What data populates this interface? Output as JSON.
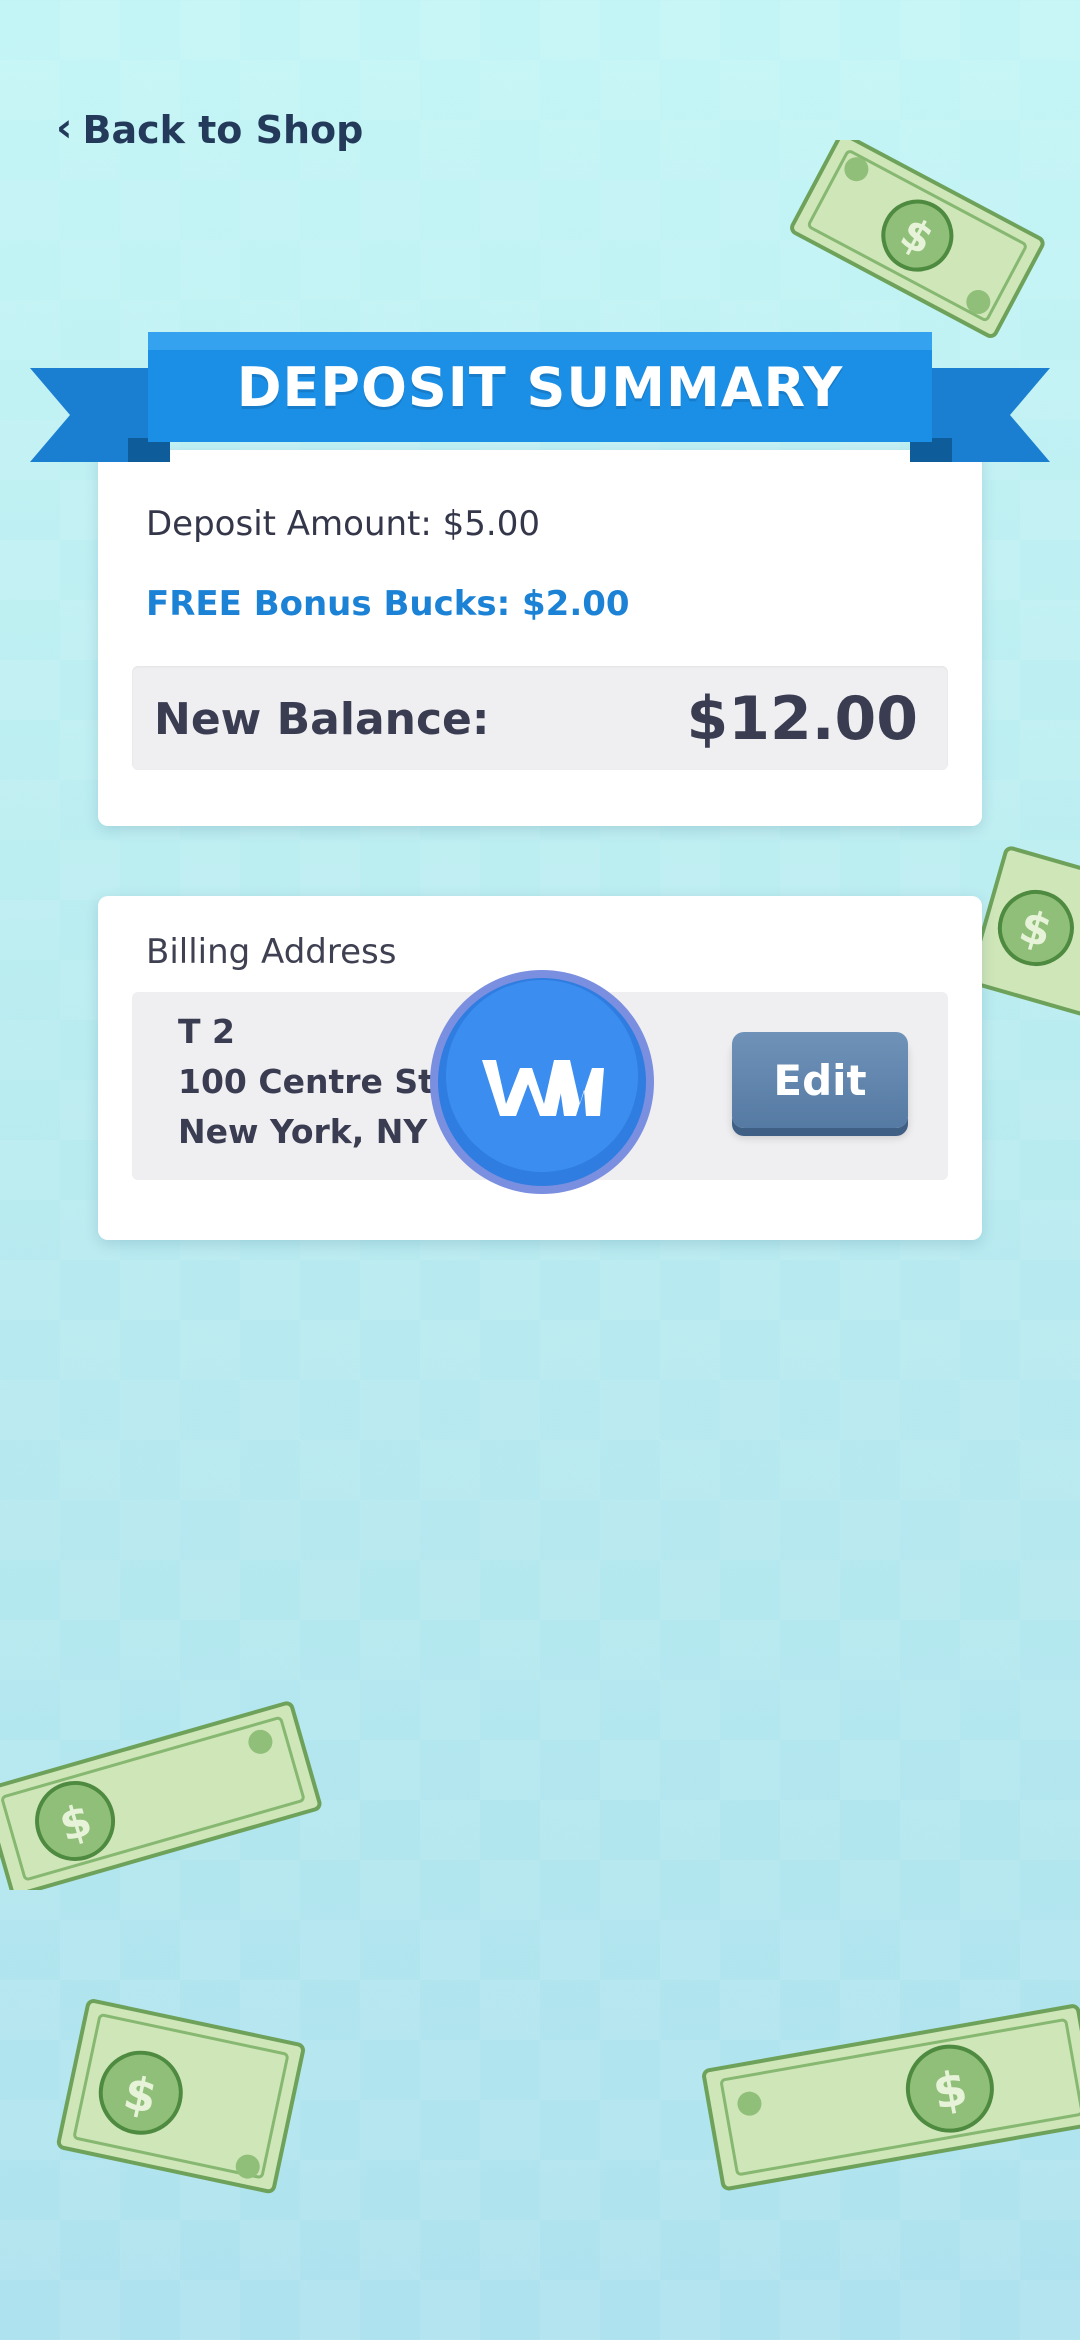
{
  "nav": {
    "back_label": "Back to Shop"
  },
  "banner": {
    "title": "DEPOSIT SUMMARY"
  },
  "summary": {
    "deposit_amount": "Deposit Amount: $5.00",
    "bonus": "FREE Bonus Bucks: $2.00",
    "new_balance_label": "New Balance:",
    "new_balance_value": "$12.00"
  },
  "billing": {
    "title": "Billing Address",
    "line1": "T 2",
    "line2": "100 Centre St",
    "line3": "New York, NY",
    "edit_label": "Edit"
  },
  "icons": {
    "back": "chevron-left-icon",
    "logo": "ww-logo",
    "bill": "dollar-bill"
  },
  "colors": {
    "banner_blue": "#1b8fe6",
    "bonus_blue": "#1c82d6",
    "edit_button": "#5f85b0",
    "background": "#bdf0f3",
    "bill_green": "#7fb86a"
  }
}
